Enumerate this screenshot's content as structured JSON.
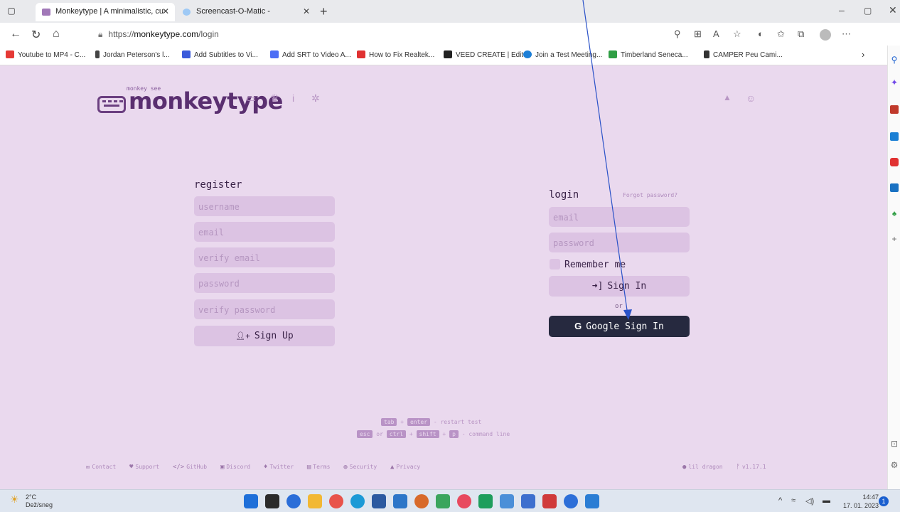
{
  "browser": {
    "tabs": [
      {
        "title": "Monkeytype | A minimalistic, cu"
      },
      {
        "title": "Screencast-O-Matic -"
      }
    ],
    "url": {
      "prefix": "https://",
      "host": "monkeytype.com",
      "path": "/login"
    },
    "bookmarks": [
      {
        "label": "Youtube to MP4 - C...",
        "color": "#e53935"
      },
      {
        "label": "Jordan Peterson's l...",
        "color": "#333333"
      },
      {
        "label": "Add Subtitles to Vi...",
        "color": "#3b5bdb"
      },
      {
        "label": "Add SRT to Video A...",
        "color": "#4c6ef5"
      },
      {
        "label": "How to Fix Realtek...",
        "color": "#e03131"
      },
      {
        "label": "VEED CREATE | Edit",
        "color": "#222222"
      },
      {
        "label": "Join a Test Meeting...",
        "color": "#1c7ed6"
      },
      {
        "label": "Timberland Seneca...",
        "color": "#2f9e44"
      },
      {
        "label": "CAMPER Peu Cami...",
        "color": "#333333"
      }
    ]
  },
  "site": {
    "logo_top": "monkey see",
    "logo_text": "monkeytype",
    "logo_badge": "m-t"
  },
  "register": {
    "title": "register",
    "username_placeholder": "username",
    "email_placeholder": "email",
    "verify_email_placeholder": "verify email",
    "password_placeholder": "password",
    "verify_password_placeholder": "verify password",
    "signup_label": "Sign Up"
  },
  "login": {
    "title": "login",
    "forgot_label": "Forgot password?",
    "email_placeholder": "email",
    "password_placeholder": "password",
    "remember_label": "Remember me",
    "signin_label": "Sign In",
    "or_label": "or",
    "google_label": "Google Sign In",
    "google_letter": "G"
  },
  "shortcuts": {
    "row1": {
      "k1": "tab",
      "plus": "+",
      "k2": "enter",
      "desc": "- restart test"
    },
    "row2": {
      "k1": "esc",
      "or": "or",
      "k2": "ctrl",
      "k3": "shift",
      "k4": "p",
      "plus": "+",
      "desc": "- command line"
    }
  },
  "footer": {
    "links": [
      "Contact",
      "Support",
      "GitHub",
      "Discord",
      "Twitter",
      "Terms",
      "Security",
      "Privacy"
    ],
    "theme": "lil dragon",
    "version": "v1.17.1"
  },
  "taskbar": {
    "temp": "2°C",
    "weather": "Dež/sneg",
    "time": "14:47",
    "date": "17. 01. 2023",
    "notif_count": "1"
  }
}
